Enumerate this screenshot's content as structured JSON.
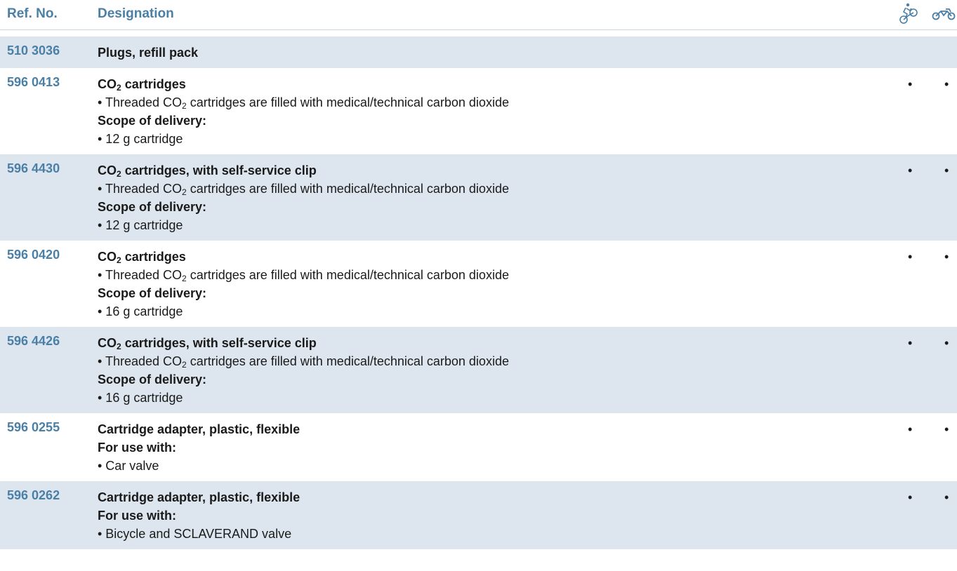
{
  "header": {
    "ref_label": "Ref. No.",
    "designation_label": "Designation",
    "icons": [
      "bicycle-icon",
      "motorcycle-icon"
    ]
  },
  "colors": {
    "accent": "#4a7fa6",
    "row_shade": "#dde6ef"
  },
  "rows": [
    {
      "ref": "510 3036",
      "shaded": true,
      "lines": [
        {
          "type": "title",
          "parts": [
            "Plugs, refill pack"
          ]
        }
      ],
      "bike": "",
      "moto": ""
    },
    {
      "ref": "596 0413",
      "shaded": false,
      "lines": [
        {
          "type": "title",
          "parts": [
            "CO",
            "2",
            " cartridges"
          ]
        },
        {
          "type": "desc",
          "parts": [
            "• Threaded CO",
            "2",
            " cartridges are filled with medical/technical carbon dioxide"
          ]
        },
        {
          "type": "label",
          "parts": [
            "Scope of delivery:"
          ]
        },
        {
          "type": "desc",
          "parts": [
            "• 12 g cartridge"
          ]
        }
      ],
      "bike": "•",
      "moto": "•"
    },
    {
      "ref": "596 4430",
      "shaded": true,
      "lines": [
        {
          "type": "title",
          "parts": [
            "CO",
            "2",
            " cartridges, with self-service clip"
          ]
        },
        {
          "type": "desc",
          "parts": [
            "• Threaded CO",
            "2",
            " cartridges are filled with medical/technical carbon dioxide"
          ]
        },
        {
          "type": "label",
          "parts": [
            "Scope of delivery:"
          ]
        },
        {
          "type": "desc",
          "parts": [
            "• 12 g cartridge"
          ]
        }
      ],
      "bike": "•",
      "moto": "•"
    },
    {
      "ref": "596 0420",
      "shaded": false,
      "lines": [
        {
          "type": "title",
          "parts": [
            "CO",
            "2",
            " cartridges"
          ]
        },
        {
          "type": "desc",
          "parts": [
            "• Threaded CO",
            "2",
            " cartridges are filled with medical/technical carbon dioxide"
          ]
        },
        {
          "type": "label",
          "parts": [
            "Scope of delivery:"
          ]
        },
        {
          "type": "desc",
          "parts": [
            "• 16 g cartridge"
          ]
        }
      ],
      "bike": "•",
      "moto": "•"
    },
    {
      "ref": "596 4426",
      "shaded": true,
      "lines": [
        {
          "type": "title",
          "parts": [
            "CO",
            "2",
            " cartridges, with self-service clip"
          ]
        },
        {
          "type": "desc",
          "parts": [
            "• Threaded CO",
            "2",
            " cartridges are filled with medical/technical carbon dioxide"
          ]
        },
        {
          "type": "label",
          "parts": [
            "Scope of delivery:"
          ]
        },
        {
          "type": "desc",
          "parts": [
            "• 16 g cartridge"
          ]
        }
      ],
      "bike": "•",
      "moto": "•"
    },
    {
      "ref": "596 0255",
      "shaded": false,
      "lines": [
        {
          "type": "title",
          "parts": [
            "Cartridge adapter, plastic, flexible"
          ]
        },
        {
          "type": "label",
          "parts": [
            "For use with:"
          ]
        },
        {
          "type": "desc",
          "parts": [
            "• Car valve"
          ]
        }
      ],
      "bike": "•",
      "moto": "•"
    },
    {
      "ref": "596 0262",
      "shaded": true,
      "lines": [
        {
          "type": "title",
          "parts": [
            "Cartridge adapter, plastic, flexible"
          ]
        },
        {
          "type": "label",
          "parts": [
            "For use with:"
          ]
        },
        {
          "type": "desc",
          "parts": [
            "• Bicycle and SCLAVERAND valve"
          ]
        }
      ],
      "bike": "•",
      "moto": "•"
    }
  ]
}
